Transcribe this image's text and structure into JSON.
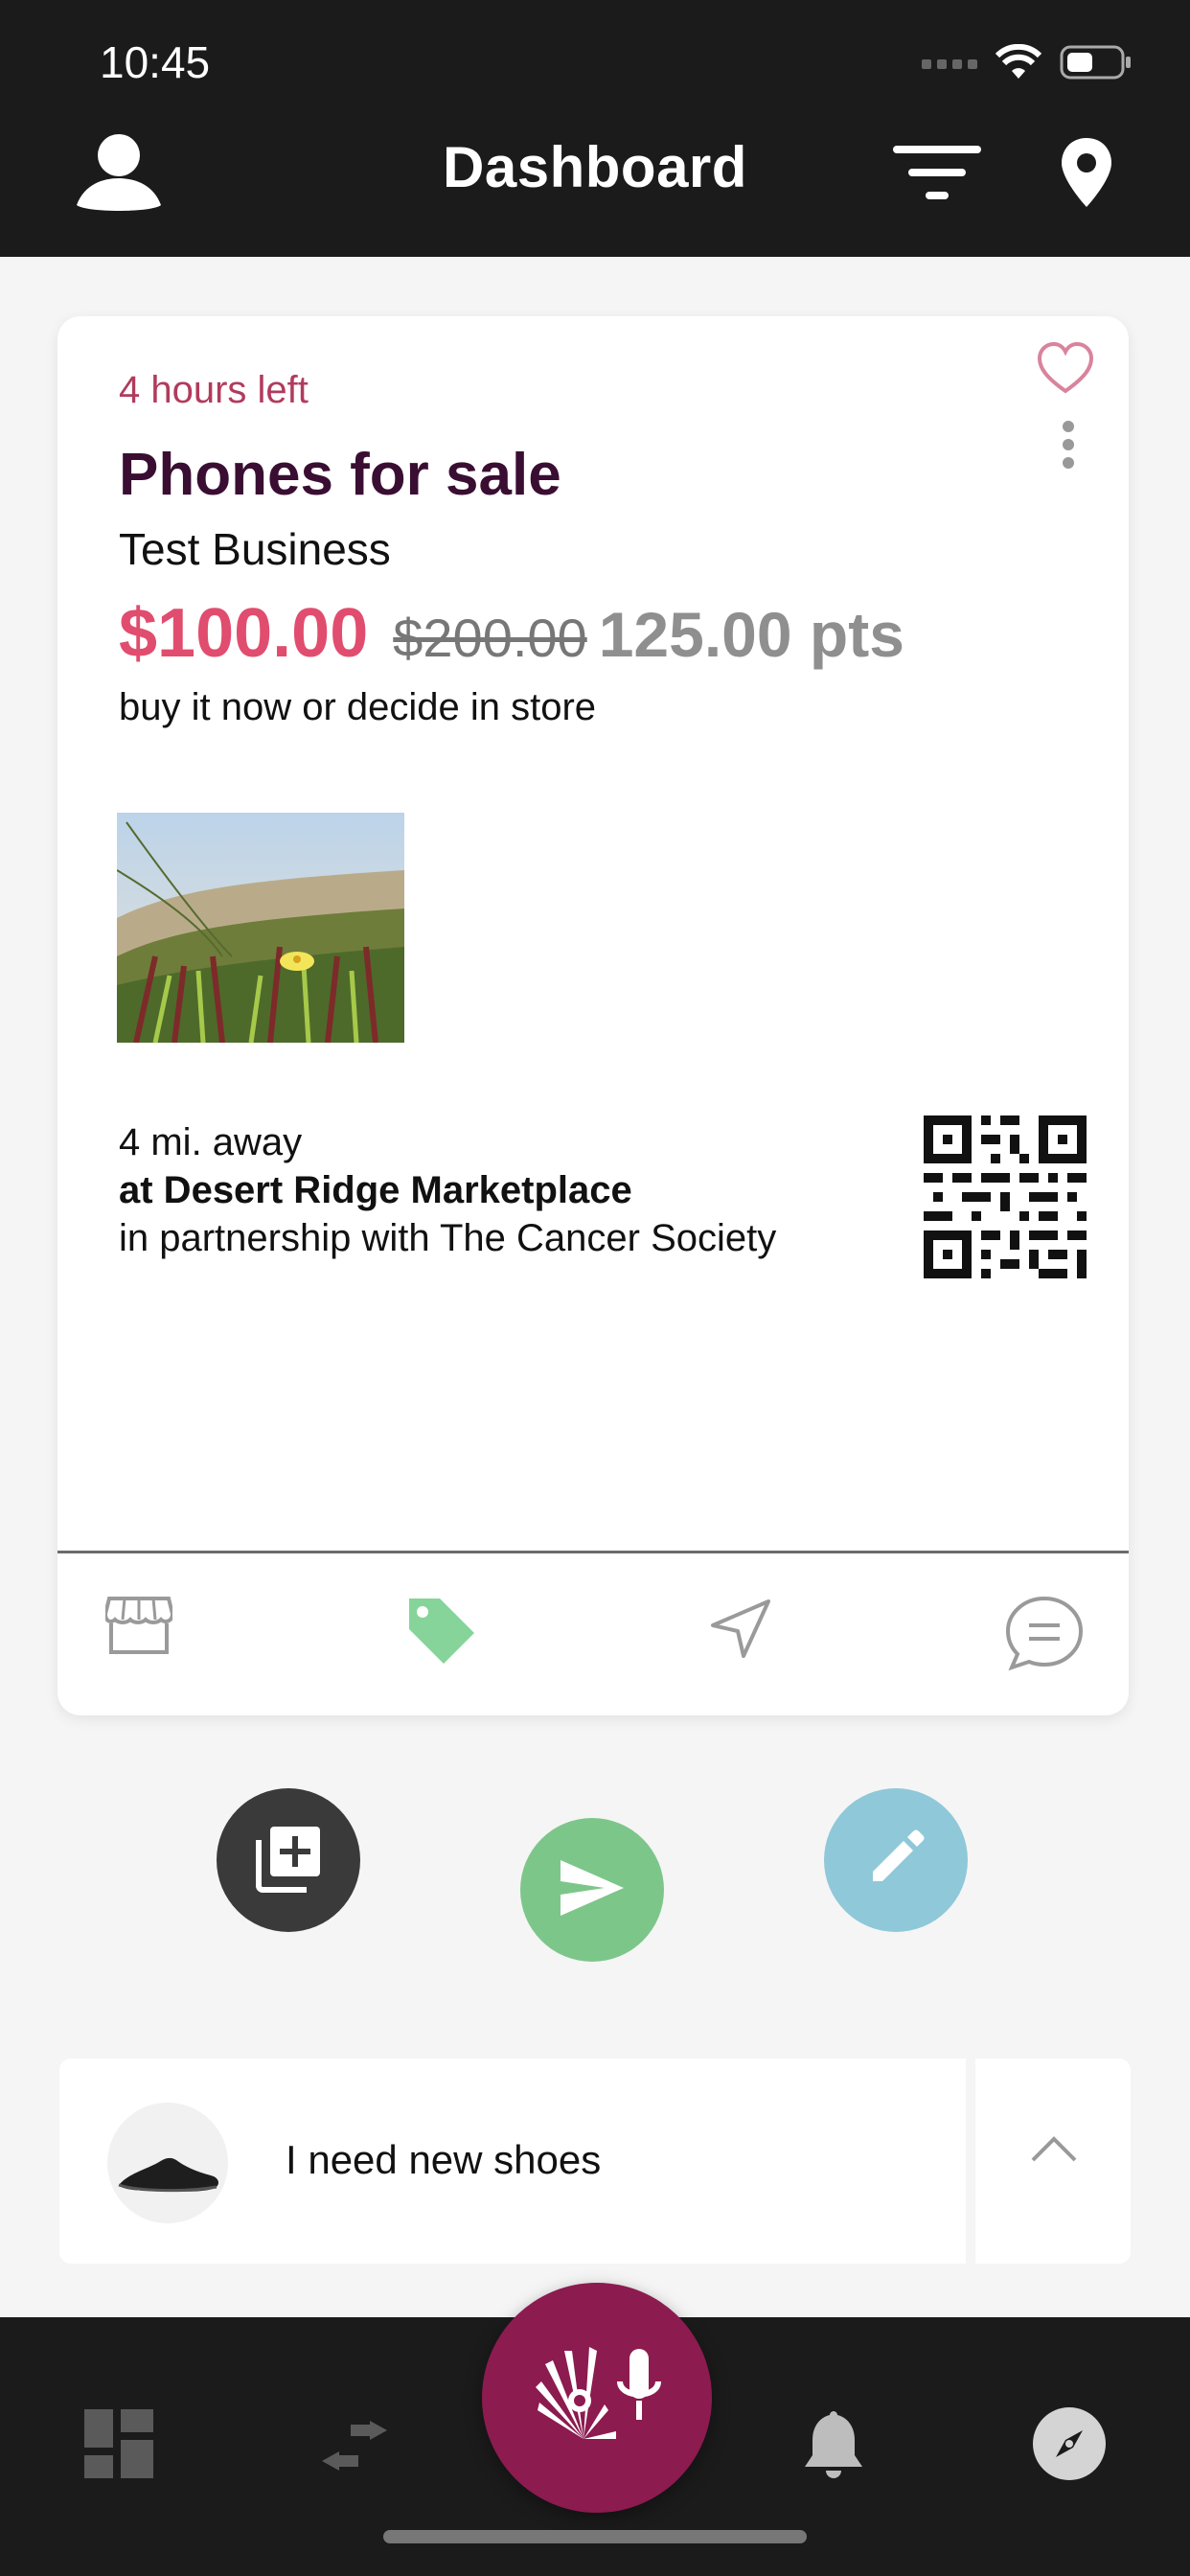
{
  "status_bar": {
    "time": "10:45"
  },
  "header": {
    "title": "Dashboard"
  },
  "card": {
    "time_left": "4 hours left",
    "title": "Phones for sale",
    "business": "Test Business",
    "price_now": "$100.00",
    "price_original": "$200.00",
    "price_points": "125.00 pts",
    "subtitle": "buy it now or decide in store",
    "distance": "4 mi. away",
    "location": "at Desert Ridge Marketplace",
    "partner": "in partnership with The Cancer Society"
  },
  "preview": {
    "text": "I need new shoes"
  },
  "colors": {
    "accent": "#8c1b4f",
    "price_red": "#e14d6e",
    "time_left": "#b23b5c",
    "send_green": "#7dc68a",
    "edit_blue": "#8fc8d9",
    "tag_green": "#86d49a"
  },
  "icons": {
    "header": [
      "user-icon",
      "filter-icon",
      "location-pin-icon"
    ],
    "card_actions": [
      "store-icon",
      "tag-icon",
      "send-arrow-icon",
      "chat-icon"
    ],
    "fabs": [
      "add-to-collection-icon",
      "send-icon",
      "edit-pencil-icon"
    ],
    "nav": [
      "dashboard-icon",
      "exchange-icon",
      "microphone-icon",
      "bell-icon",
      "compass-icon"
    ]
  }
}
